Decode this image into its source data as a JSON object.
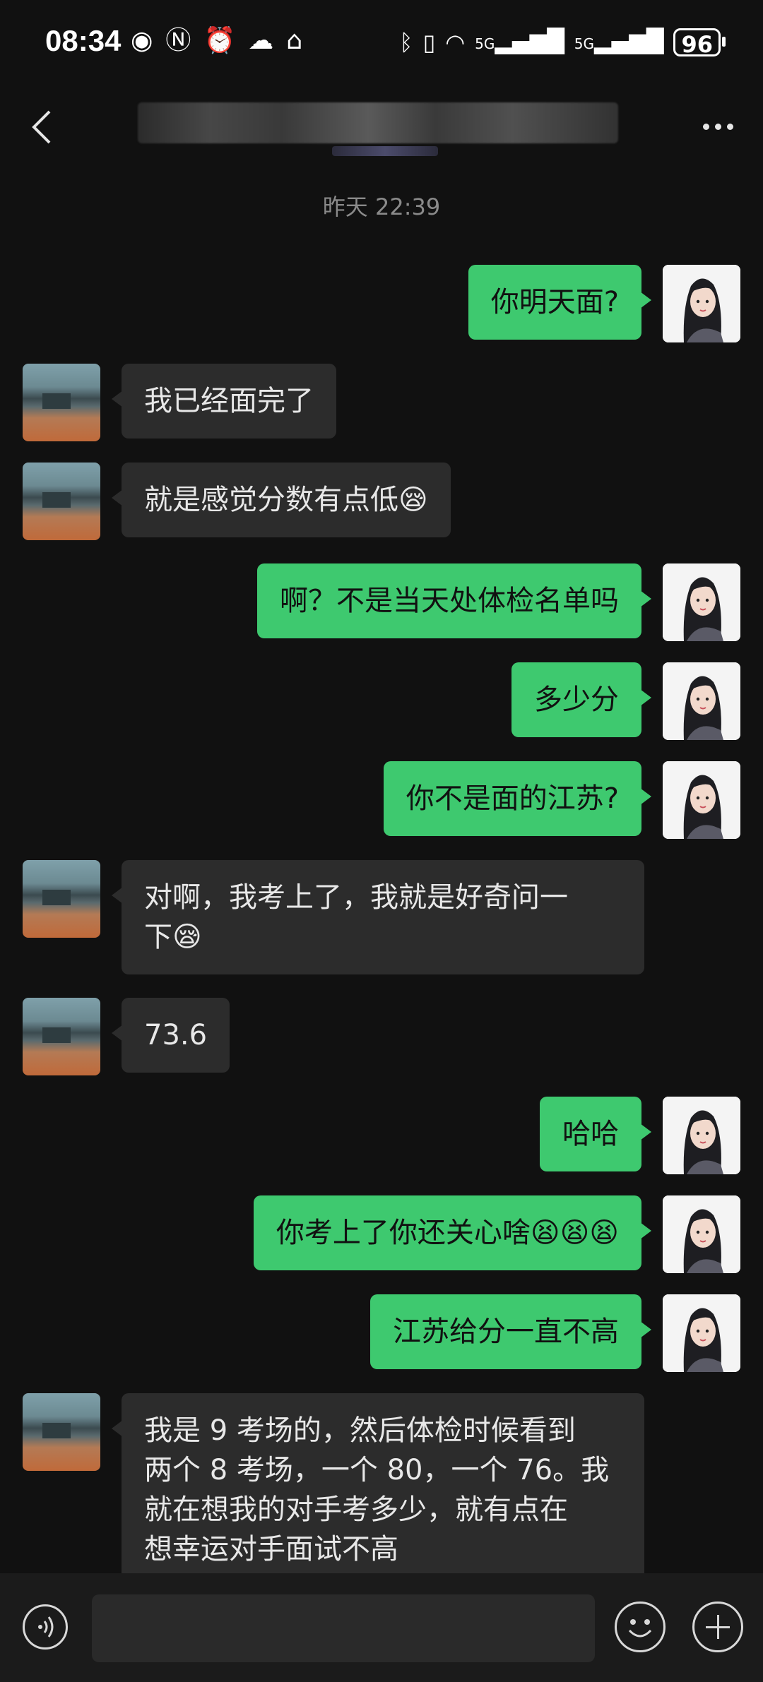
{
  "status_bar": {
    "time": "08:34",
    "left_icons": [
      "eye-icon",
      "nfc-icon",
      "alarm-icon",
      "app-notification-icon",
      "app-notification-icon"
    ],
    "right_icons": [
      "bluetooth-icon",
      "vibrate-icon",
      "wifi-icon",
      "signal-5g-icon",
      "signal-5g-icon"
    ],
    "network_label_1": "5G",
    "network_label_2": "5G",
    "battery": "96"
  },
  "nav": {
    "back_icon": "chevron-left-icon",
    "more_icon": "more-dots-icon"
  },
  "timestamp": "昨天 22:39",
  "messages": [
    {
      "from": "me",
      "text": "你明天面?"
    },
    {
      "from": "them",
      "text": "我已经面完了"
    },
    {
      "from": "them",
      "text": "就是感觉分数有点低😪"
    },
    {
      "from": "me",
      "text": "啊？不是当天处体检名单吗"
    },
    {
      "from": "me",
      "text": "多少分"
    },
    {
      "from": "me",
      "text": "你不是面的江苏?"
    },
    {
      "from": "them",
      "text": "对啊，我考上了，我就是好奇问一\n下😪"
    },
    {
      "from": "them",
      "text": "73.6"
    },
    {
      "from": "me",
      "text": "哈哈"
    },
    {
      "from": "me",
      "text": "你考上了你还关心啥😫😫😫"
    },
    {
      "from": "me",
      "text": "江苏给分一直不高"
    },
    {
      "from": "them",
      "text": "我是 9 考场的，然后体检时候看到\n两个 8 考场，一个 80，一个 76。我\n就在想我的对手考多少，就有点在\n想幸运对手面试不高"
    }
  ],
  "input_bar": {
    "voice_icon": "voice-icon",
    "emoji_icon": "emoji-icon",
    "plus_icon": "plus-icon",
    "input_value": ""
  },
  "colors": {
    "background": "#111111",
    "my_bubble": "#3ec96f",
    "their_bubble": "#2c2c2c"
  }
}
